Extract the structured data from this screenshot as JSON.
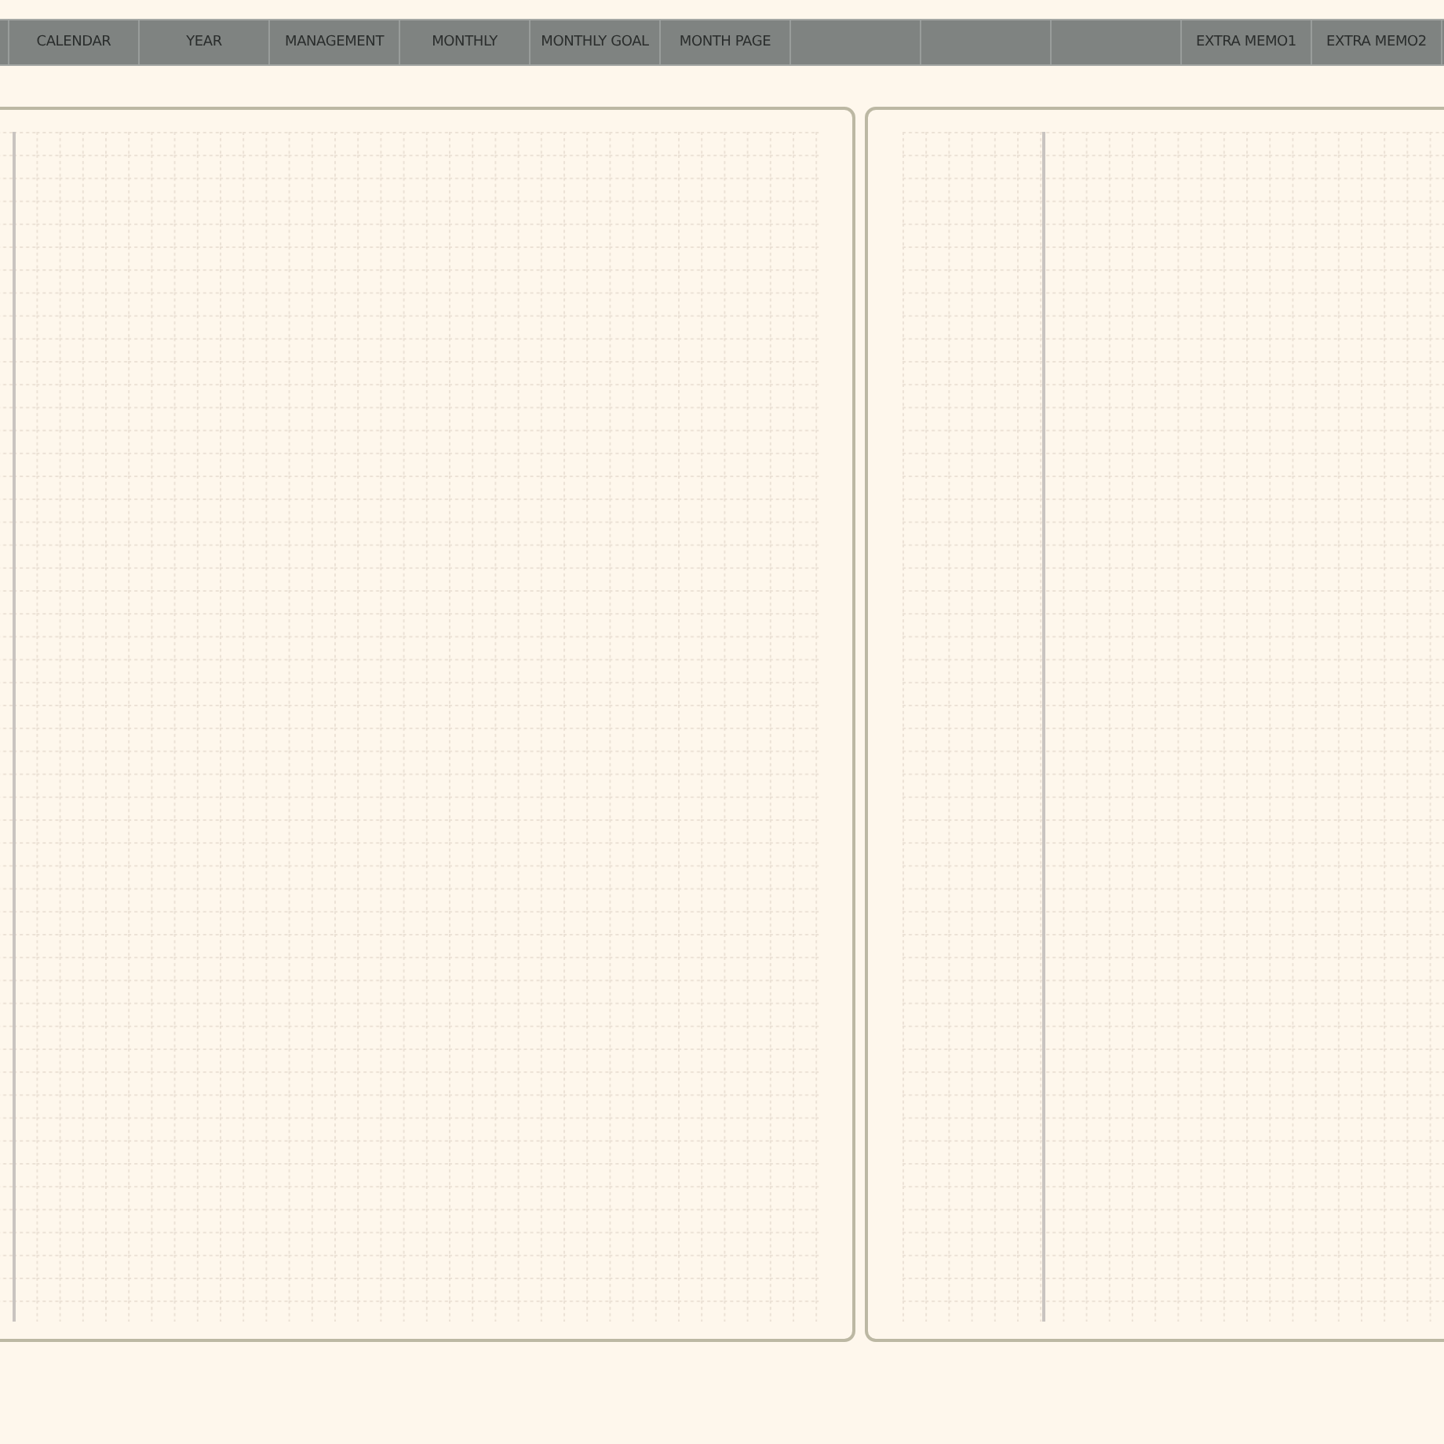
{
  "tabs": [
    {
      "kind": "blank"
    },
    {
      "kind": "labeled",
      "label": "CALENDAR"
    },
    {
      "kind": "labeled",
      "label": "YEAR"
    },
    {
      "kind": "labeled",
      "label": "MANAGEMENT"
    },
    {
      "kind": "labeled",
      "label": "MONTHLY"
    },
    {
      "kind": "labeled",
      "label": "MONTHLY GOAL"
    },
    {
      "kind": "labeled",
      "label": "MONTH PAGE"
    },
    {
      "kind": "blank"
    },
    {
      "kind": "blank"
    },
    {
      "kind": "blank"
    },
    {
      "kind": "labeled",
      "label": "EXTRA MEMO1"
    },
    {
      "kind": "labeled",
      "label": "EXTRA MEMO2"
    }
  ]
}
